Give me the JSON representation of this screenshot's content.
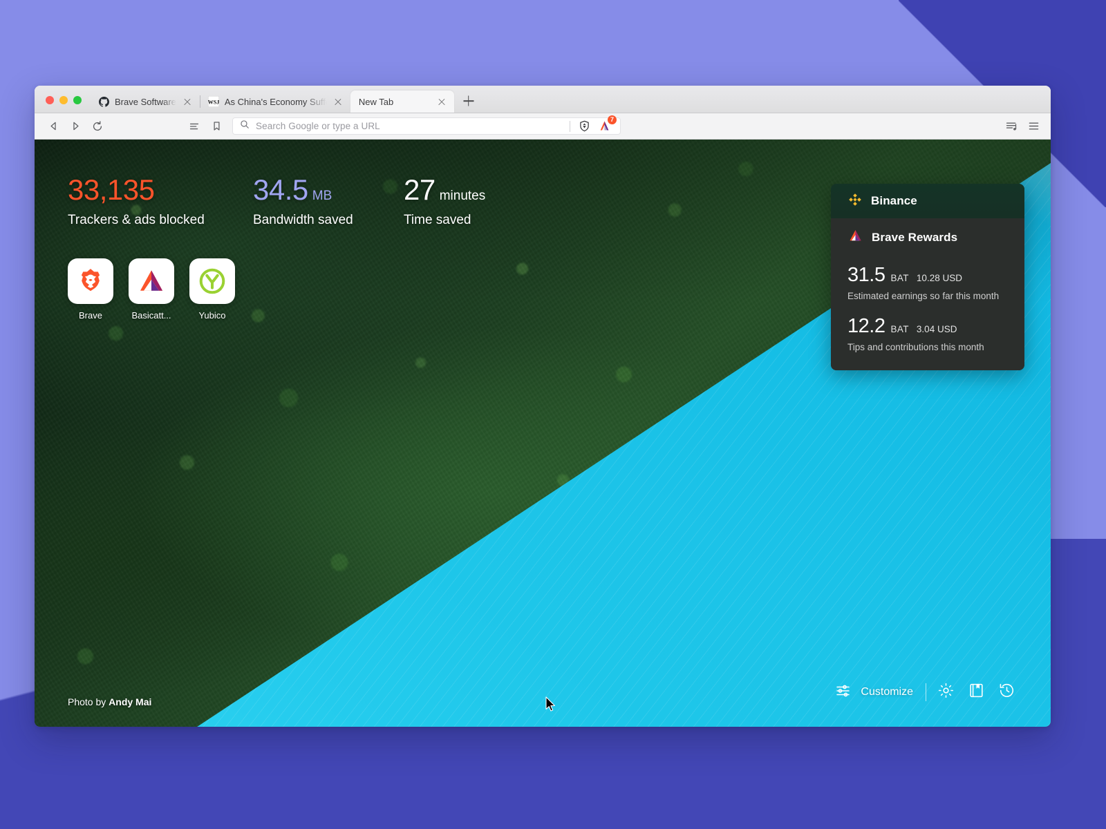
{
  "desktop": {
    "bg_color": "#868ce8",
    "corner_accent_color": "#4347b6"
  },
  "browser": {
    "window_controls": [
      {
        "name": "close",
        "color": "#ff5f57"
      },
      {
        "name": "minimize",
        "color": "#febc2e"
      },
      {
        "name": "maximize",
        "color": "#28c840"
      }
    ],
    "tabs": [
      {
        "title": "Brave Software",
        "favicon": "github-icon",
        "active": false
      },
      {
        "title": "As China's Economy Suffers, Xi Fa",
        "favicon": "wsj-icon",
        "active": false
      },
      {
        "title": "New Tab",
        "favicon": "none",
        "active": true
      }
    ],
    "new_tab_button": "new-tab",
    "toolbar": {
      "back": "back-icon",
      "forward": "forward-icon",
      "reload": "reload-icon",
      "reading_list": "reading-list-icon",
      "bookmark": "bookmark-icon",
      "search_icon": "search-icon",
      "omnibox_value": "",
      "omnibox_placeholder": "Search Google or type a URL",
      "shields": "brave-shield-icon",
      "rewards": "brave-rewards-icon",
      "rewards_badge": "7",
      "media_playlist": "media-playlist-icon",
      "app_menu": "hamburger-menu-icon"
    }
  },
  "newtab": {
    "stats": [
      {
        "value": "33,135",
        "unit": "",
        "label": "Trackers & ads blocked",
        "color": "#fb542b"
      },
      {
        "value": "34.5",
        "unit": "MB",
        "label": "Bandwidth saved",
        "color": "#a0a5f0"
      },
      {
        "value": "27",
        "unit": "minutes",
        "label": "Time saved",
        "color": "#ffffff"
      }
    ],
    "top_sites": [
      {
        "name": "Brave",
        "icon": "brave-lion-icon"
      },
      {
        "name": "Basicatt...",
        "icon": "bat-triangle-icon"
      },
      {
        "name": "Yubico",
        "icon": "yubico-y-icon"
      }
    ],
    "rewards_widget": {
      "tab_label": "Binance",
      "tab_icon": "binance-icon",
      "title": "Brave Rewards",
      "title_icon": "bat-triangle-icon",
      "entries": [
        {
          "amount": "31.5",
          "token": "BAT",
          "usd": "10.28 USD",
          "description": "Estimated earnings so far this month"
        },
        {
          "amount": "12.2",
          "token": "BAT",
          "usd": "3.04 USD",
          "description": "Tips and contributions this month"
        }
      ]
    },
    "bottom_bar": {
      "customize_label": "Customize",
      "customize_icon": "sliders-icon",
      "settings_icon": "gear-icon",
      "bookmarks_icon": "bookmarks-book-icon",
      "history_icon": "history-clock-icon"
    },
    "photo_credit_prefix": "Photo by ",
    "photo_credit_author": "Andy Mai"
  }
}
